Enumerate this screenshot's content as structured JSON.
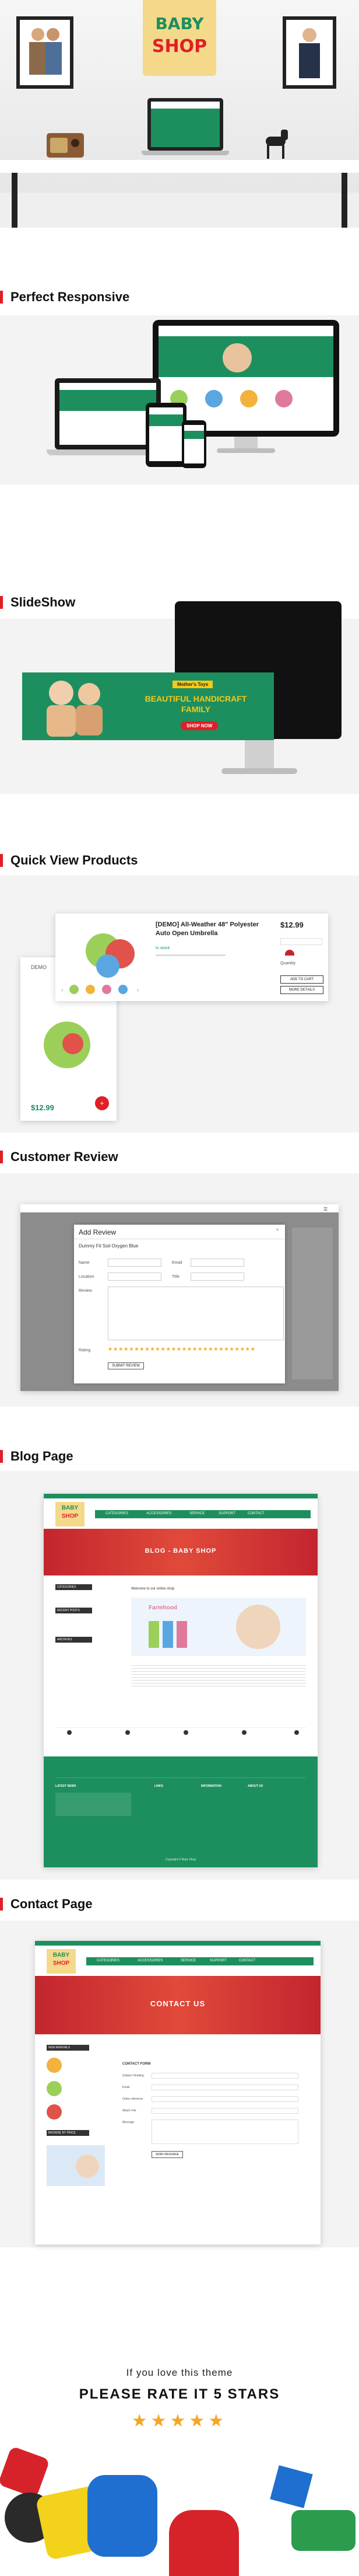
{
  "logo": {
    "line1": "BABY",
    "line2": "SHOP"
  },
  "sections": {
    "responsive": "Perfect Responsive",
    "slideshow": "SlideShow",
    "quickview": "Quick View Products",
    "review": "Customer Review",
    "blog": "Blog Page",
    "contact": "Contact Page"
  },
  "slide": {
    "small": "Mother's Toys",
    "headline": "BEAUTIFUL HANDICRAFT FAMILY",
    "cta": "SHOP NOW"
  },
  "quickview": {
    "product_name": "[DEMO] All-Weather 48\" Polyester Auto Open Umbrella",
    "price": "$12.99",
    "side_price": "$12.99",
    "in_stock": "In stock",
    "add_to_cart": "ADD TO CART",
    "more_details": "MORE DETAILS",
    "demo_label": "DEMO",
    "quantity_label": "Quantity"
  },
  "review": {
    "modal_title": "Add Review",
    "product": "Dummy Fit Soil Oxygen Blue",
    "fields": [
      "Name",
      "Email",
      "Location",
      "Title",
      "Review",
      "Rating"
    ],
    "submit": "SUBMIT REVIEW"
  },
  "blog": {
    "banner": "BLOG - BABY SHOP",
    "nav": [
      "CATEGORIES",
      "ACCESSORIES",
      "SERVICE",
      "SUPPORT",
      "CONTACT"
    ],
    "sidebar": [
      "CATEGORIES",
      "RECENT POSTS",
      "ARCHIVES"
    ],
    "post_title": "Welcome to our online shop",
    "post_image_text": "Farmhood",
    "footer_cols": [
      "LATEST NEWS",
      "LINKS",
      "INFORMATION",
      "ABOUT US"
    ],
    "copyright": "Copyright © Baby Shop"
  },
  "contact": {
    "banner": "CONTACT US",
    "sidebar": [
      "NEW ARRIVALS",
      "BROWSE BY PRICE"
    ],
    "form_title": "CONTACT FORM",
    "fields": [
      "Subject Heading",
      "Email",
      "Order reference",
      "Attach File",
      "Message"
    ],
    "send": "SEND MESSAGE"
  },
  "rate": {
    "line1": "If you love this theme",
    "line2": "PLEASE RATE IT 5 STARS",
    "stars": 5
  },
  "colors": {
    "accent": "#e01f26",
    "green": "#1d8f5e",
    "yellow": "#f6c915",
    "star": "#f5a623"
  }
}
